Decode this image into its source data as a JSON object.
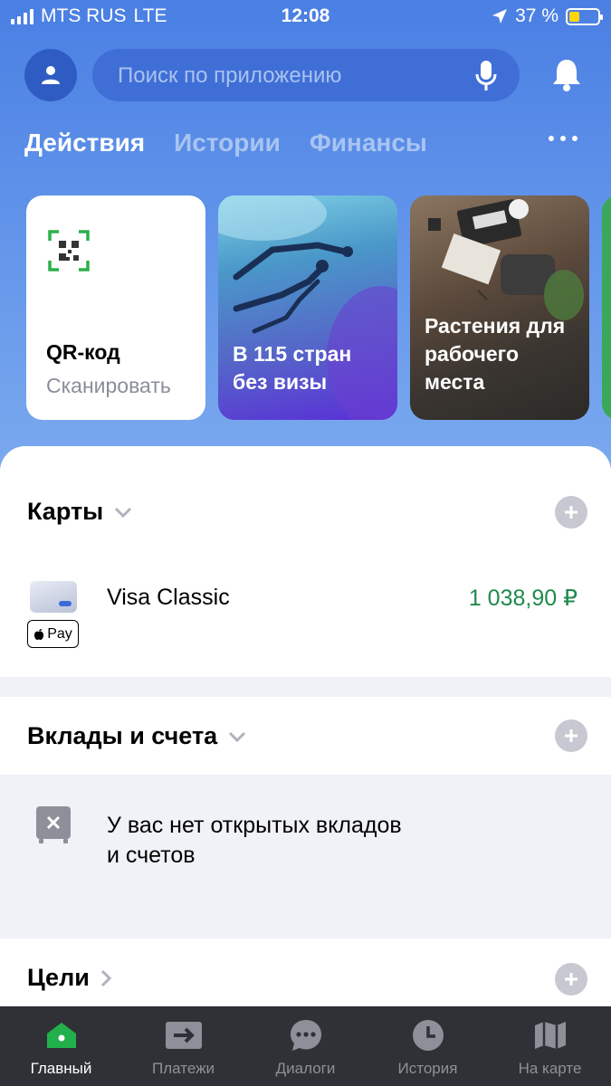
{
  "status_bar": {
    "carrier": "MTS RUS",
    "network": "LTE",
    "time": "12:08",
    "battery": "37 %",
    "battery_level": 0.37
  },
  "search": {
    "placeholder": "Поиск по приложению"
  },
  "tabs": [
    {
      "label": "Действия",
      "active": true
    },
    {
      "label": "Истории",
      "active": false
    },
    {
      "label": "Финансы",
      "active": false
    }
  ],
  "stories": {
    "qr": {
      "title": "QR-код",
      "subtitle": "Сканировать"
    },
    "visa": {
      "text": "В 115 стран\nбез визы"
    },
    "plants": {
      "text": "Растения для\nрабочего\nместа"
    }
  },
  "cards_section": {
    "title": "Карты",
    "items": [
      {
        "name": "Visa Classic",
        "amount": "1 038,90 ₽",
        "badge": "Pay"
      }
    ]
  },
  "deposits_section": {
    "title": "Вклады и счета",
    "empty_text": "У вас нет открытых вкладов\nи счетов"
  },
  "goals_section": {
    "title": "Цели"
  },
  "bottom_nav": [
    {
      "label": "Главный",
      "icon": "home-icon",
      "active": true
    },
    {
      "label": "Платежи",
      "icon": "payments-icon",
      "active": false
    },
    {
      "label": "Диалоги",
      "icon": "chat-icon",
      "active": false
    },
    {
      "label": "История",
      "icon": "clock-icon",
      "active": false
    },
    {
      "label": "На карте",
      "icon": "map-icon",
      "active": false
    }
  ],
  "colors": {
    "accent": "#4a7fe3",
    "green": "#1e8a4c",
    "nav_bg": "#2f3136"
  }
}
